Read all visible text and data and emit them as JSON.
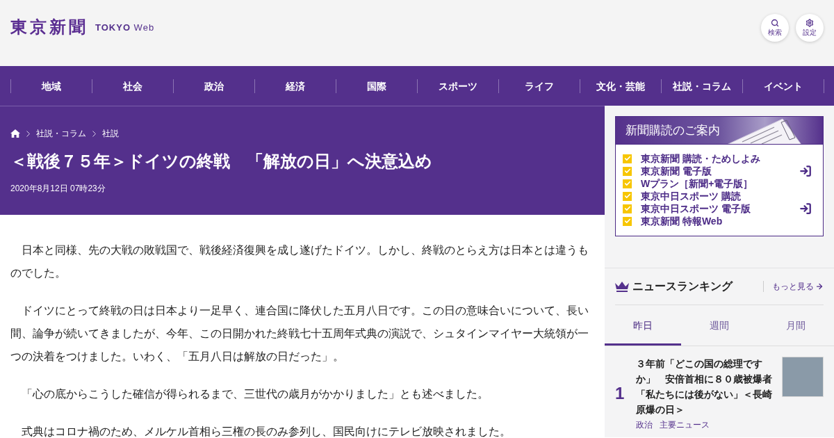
{
  "header": {
    "logo": "東京新聞",
    "logo_subtitle": "**TOKYO** Web",
    "buttons": [
      {
        "kind": "search",
        "label": "検索"
      },
      {
        "kind": "settings",
        "label": "設定"
      }
    ]
  },
  "nav": {
    "items": [
      "地域",
      "社会",
      "政治",
      "経済",
      "国際",
      "スポーツ",
      "ライフ",
      "文化・芸能",
      "社説・コラム",
      "イベント"
    ]
  },
  "article": {
    "breadcrumb": [
      "社説・コラム",
      "社説"
    ],
    "title": "＜戦後７５年＞ドイツの終戦　「解放の日」へ決意込め",
    "date": "2020年8月12日 07時23分",
    "paragraphs": [
      "　日本と同様、先の大戦の敗戦国で、戦後経済復興を成し遂げたドイツ。しかし、終戦のとらえ方は日本とは違うものでした。",
      "　ドイツにとって終戦の日は日本より一足早く、連合国に降伏した五月八日です。この日の意味合いについて、長い間、論争が続いてきましたが、今年、この日開かれた終戦七十五周年式典の演説で、シュタインマイヤー大統領が一つの決着をつけました。いわく、「五月八日は解放の日だった」。",
      "　「心の底からこうした確信が得られるまで、三世代の歳月がかかりました」とも述べました。",
      "　式典はコロナ禍のため、メルケル首相ら三権の長のみ参列し、国民向けにテレビ放映されました。"
    ]
  },
  "subscription": {
    "title": "新聞購読のご案内",
    "items": [
      {
        "label": "東京新聞 購読・ためしよみ",
        "login_icon": false
      },
      {
        "label": "東京新聞 電子版",
        "login_icon": true
      },
      {
        "label": "Wプラン［新聞+電子版］",
        "login_icon": false
      },
      {
        "label": "東京中日スポーツ 購読",
        "login_icon": false
      },
      {
        "label": "東京中日スポーツ 電子版",
        "login_icon": true
      },
      {
        "label": "東京新聞 特報Web",
        "login_icon": false
      }
    ]
  },
  "ranking": {
    "title": "ニュースランキング",
    "more_link": "もっと見る",
    "tabs": [
      {
        "label": "昨日",
        "selected": true
      },
      {
        "label": "週間",
        "selected": false
      },
      {
        "label": "月間",
        "selected": false
      }
    ],
    "items": [
      {
        "rank": "1",
        "title": "３年前「どこの国の総理ですか」　安倍首相に８０歳被爆者「私たちには後がない」＜長崎原爆の日＞",
        "tags": [
          "政治",
          "主要ニュース"
        ]
      }
    ]
  }
}
